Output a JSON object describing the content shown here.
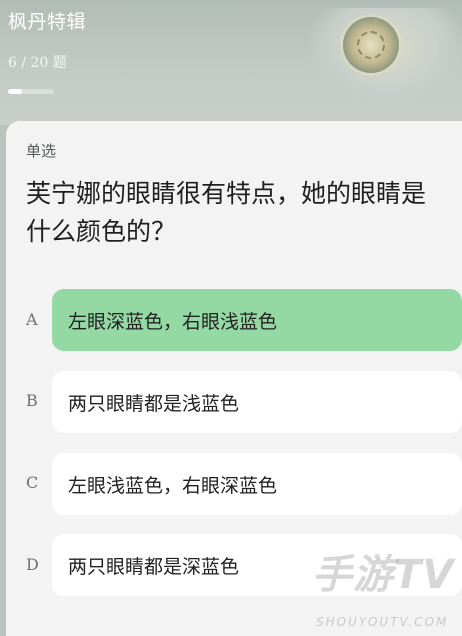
{
  "header": {
    "title": "枫丹特辑",
    "progress_text": "6 / 20 题",
    "progress_fraction": 0.3,
    "emblem_icon": "hydro-emblem-icon"
  },
  "question": {
    "type_label": "单选",
    "text": "芙宁娜的眼睛很有特点，她的眼睛是什么颜色的？",
    "options": [
      {
        "letter": "A",
        "text": "左眼深蓝色，右眼浅蓝色",
        "selected": true
      },
      {
        "letter": "B",
        "text": "两只眼睛都是浅蓝色",
        "selected": false
      },
      {
        "letter": "C",
        "text": "左眼浅蓝色，右眼深蓝色",
        "selected": false
      },
      {
        "letter": "D",
        "text": "两只眼睛都是深蓝色",
        "selected": false
      }
    ]
  },
  "watermark": {
    "main": "手游TV",
    "sub": "SHOUYOUTV.COM"
  },
  "colors": {
    "selected_option": "#94d9a4",
    "card_background": "#f2f3f2",
    "header_background": "#b9c2bd"
  }
}
